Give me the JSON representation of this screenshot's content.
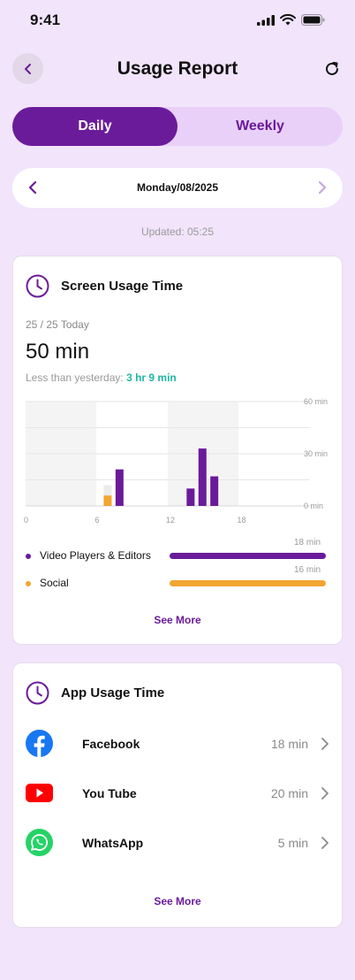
{
  "status_bar": {
    "time": "9:41"
  },
  "header": {
    "title": "Usage Report"
  },
  "tabs": [
    {
      "label": "Daily",
      "active": true
    },
    {
      "label": "Weekly",
      "active": false
    }
  ],
  "date_nav": {
    "date": "Monday/08/2025"
  },
  "updated": "Updated: 05:25",
  "screen_usage": {
    "title": "Screen Usage Time",
    "today_count": "25 / 25 Today",
    "total": "50 min",
    "compare_prefix": "Less than yesterday: ",
    "compare_value": "3 hr 9 min",
    "legend": [
      {
        "name": "Video Players & Editors",
        "value": "18 min",
        "color": "#6A1B9A"
      },
      {
        "name": "Social",
        "value": "16 min",
        "color": "#F2A531"
      }
    ],
    "see_more": "See More"
  },
  "chart_data": {
    "type": "bar",
    "x_ticks": [
      "0",
      "6",
      "12",
      "18"
    ],
    "y_ticks": [
      "60 min",
      "30 min",
      "0 min"
    ],
    "ylim": [
      0,
      60
    ],
    "xlim": [
      0,
      24
    ],
    "series": [
      {
        "name": "Video Players & Editors",
        "color": "#6A1B9A",
        "points": [
          {
            "hour": 8,
            "value": 21
          },
          {
            "hour": 14,
            "value": 10
          },
          {
            "hour": 15,
            "value": 33
          },
          {
            "hour": 16,
            "value": 17
          }
        ]
      },
      {
        "name": "Social",
        "color": "#F2A531",
        "points": [
          {
            "hour": 7,
            "value": 6
          }
        ]
      }
    ]
  },
  "app_usage": {
    "title": "App Usage Time",
    "apps": [
      {
        "name": "Facebook",
        "time": "18 min",
        "icon": "facebook-icon"
      },
      {
        "name": "You Tube",
        "time": "20 min",
        "icon": "youtube-icon"
      },
      {
        "name": "WhatsApp",
        "time": "5 min",
        "icon": "whatsapp-icon"
      }
    ],
    "see_more": "See More"
  }
}
